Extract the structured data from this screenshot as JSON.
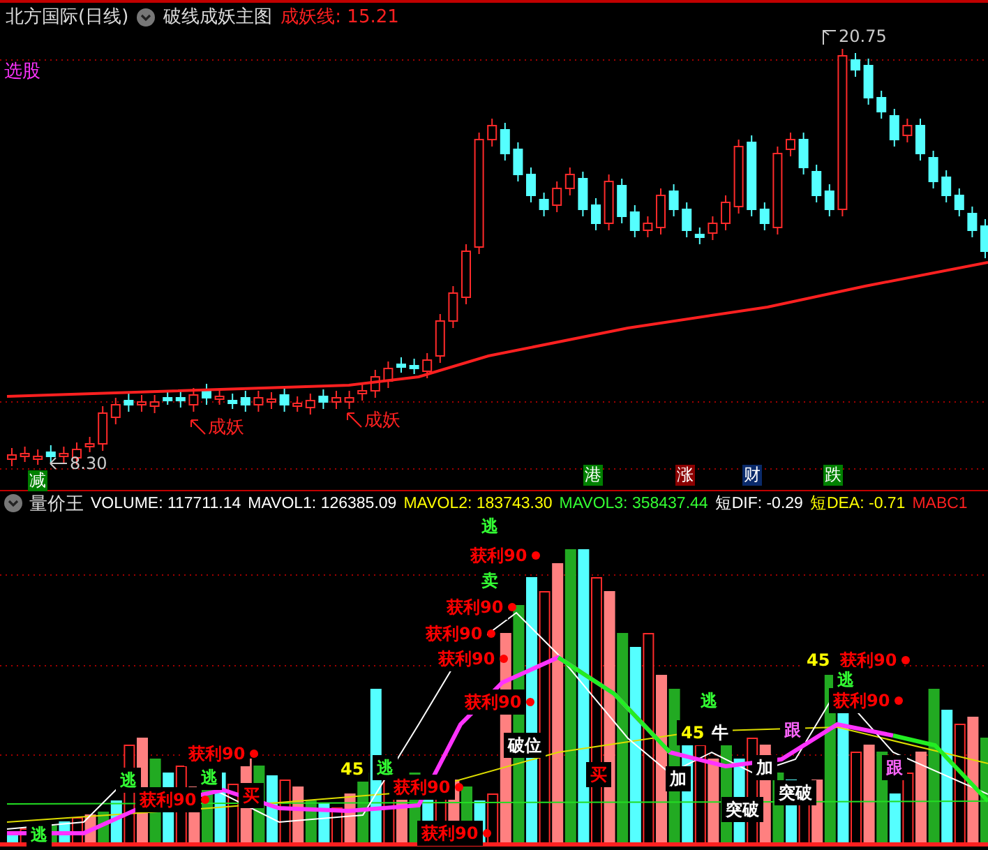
{
  "main_chart": {
    "title": "北方国际(日线)",
    "indicator": "破线成妖主图",
    "readouts": [
      {
        "text": "成妖线: 15.21",
        "color": "#ff2020"
      }
    ],
    "screen_label": "选股",
    "high_label": "20.75",
    "low_label": "8.30",
    "markers": [
      {
        "text": "成妖"
      },
      {
        "text": "成妖"
      }
    ],
    "signals": [
      {
        "text": "减",
        "color": "#008000"
      },
      {
        "text": "港",
        "color": "#008000"
      },
      {
        "text": "涨",
        "color": "#8b0000"
      },
      {
        "text": "财",
        "color": "#0a2a6a"
      },
      {
        "text": "跌",
        "color": "#008000"
      }
    ]
  },
  "volume_chart": {
    "title": "量价王",
    "readouts": [
      {
        "text": "VOLUME: 117711.14",
        "color": "#ffffff"
      },
      {
        "text": "MAVOL1: 126385.09",
        "color": "#ffffff"
      },
      {
        "text": "MAVOL2: 183743.30",
        "color": "#ffff00"
      },
      {
        "text": "MAVOL3: 358437.44",
        "color": "#33ff33"
      },
      {
        "text": "短DIF: -0.29",
        "color": "#ffffff"
      },
      {
        "text": "短DEA: -0.71",
        "color": "#ffff00"
      },
      {
        "text": "MABC1",
        "color": "#ff2020"
      }
    ],
    "annotations": [
      {
        "text": "逃",
        "color": "#33ff33",
        "dot": false
      },
      {
        "text": "获利90",
        "color": "#ff0000",
        "dot": true
      },
      {
        "text": "卖",
        "color": "#33ff33",
        "dot": false
      },
      {
        "text": "获利90",
        "color": "#ff0000",
        "dot": true
      },
      {
        "text": "获利90",
        "color": "#ff0000",
        "dot": true
      },
      {
        "text": "获利90",
        "color": "#ff0000",
        "dot": true
      },
      {
        "text": "获利90",
        "color": "#ff0000",
        "dot": true
      },
      {
        "text": "获利90",
        "color": "#ff0000",
        "dot": true
      },
      {
        "text": "逃",
        "color": "#33ff33",
        "dot": false
      },
      {
        "text": "逃",
        "color": "#33ff33",
        "dot": false
      },
      {
        "text": "获利90",
        "color": "#ff0000",
        "dot": true
      },
      {
        "text": "买",
        "color": "#ff0000",
        "dot": false
      },
      {
        "text": "45",
        "color": "#ffff00",
        "dot": false
      },
      {
        "text": "逃",
        "color": "#33ff33",
        "dot": false
      },
      {
        "text": "获利90",
        "color": "#ff0000",
        "dot": true
      },
      {
        "text": "获利90",
        "color": "#ff0000",
        "dot": true
      },
      {
        "text": "破位",
        "color": "#ffffff",
        "dot": false
      },
      {
        "text": "买",
        "color": "#ff0000",
        "dot": false
      },
      {
        "text": "逃",
        "color": "#33ff33",
        "dot": false
      },
      {
        "text": "45",
        "color": "#ffff00",
        "dot": false
      },
      {
        "text": "牛",
        "color": "#ffffff",
        "dot": false
      },
      {
        "text": "加",
        "color": "#ffffff",
        "dot": false
      },
      {
        "text": "加",
        "color": "#ffffff",
        "dot": false
      },
      {
        "text": "突破",
        "color": "#ffffff",
        "dot": false
      },
      {
        "text": "突破",
        "color": "#ffffff",
        "dot": false
      },
      {
        "text": "跟",
        "color": "#ff66ff",
        "dot": false
      },
      {
        "text": "跟",
        "color": "#ff66ff",
        "dot": false
      },
      {
        "text": "45",
        "color": "#ffff00",
        "dot": false
      },
      {
        "text": "获利90",
        "color": "#ff0000",
        "dot": true
      },
      {
        "text": "逃",
        "color": "#33ff33",
        "dot": false
      },
      {
        "text": "获利90",
        "color": "#ff0000",
        "dot": true
      },
      {
        "text": "逃",
        "color": "#33ff33",
        "dot": false
      }
    ]
  }
}
